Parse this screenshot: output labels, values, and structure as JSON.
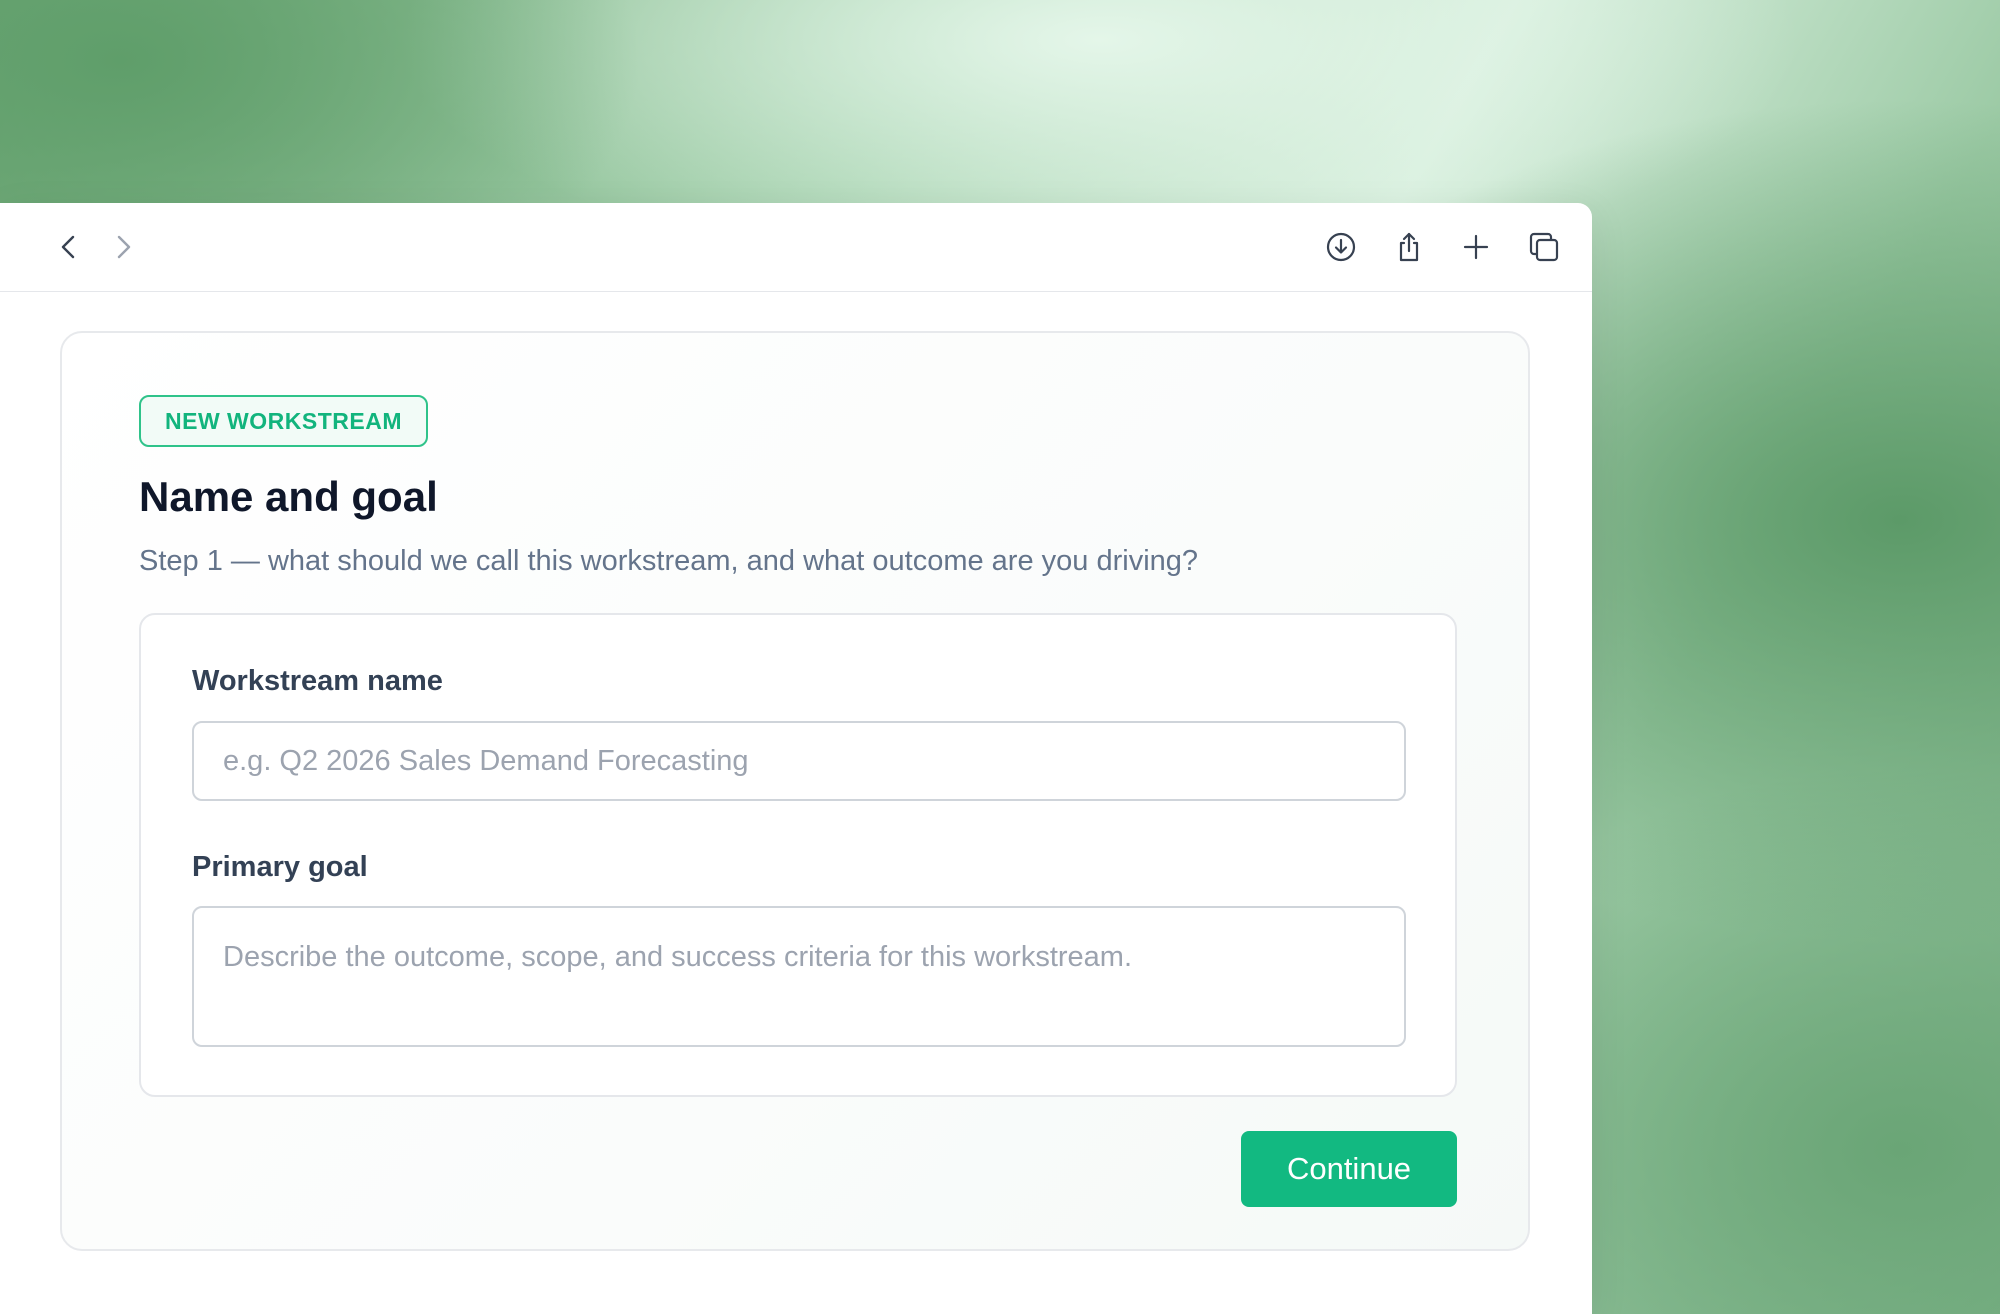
{
  "colors": {
    "accent": "#12b981",
    "badge_text": "#12b47d",
    "title": "#0f172a",
    "muted": "#64748b"
  },
  "toolbar": {
    "icons": [
      "chevron-left-icon",
      "chevron-right-icon",
      "download-icon",
      "share-icon",
      "plus-icon",
      "tabs-icon"
    ]
  },
  "card": {
    "badge": "NEW WORKSTREAM",
    "title": "Name and goal",
    "subtitle": "Step 1 — what should we call this workstream, and what outcome are you driving?"
  },
  "form": {
    "name_label": "Workstream name",
    "name_placeholder": "e.g. Q2 2026 Sales Demand Forecasting",
    "goal_label": "Primary goal",
    "goal_placeholder": "Describe the outcome, scope, and success criteria for this workstream."
  },
  "actions": {
    "continue_label": "Continue"
  }
}
